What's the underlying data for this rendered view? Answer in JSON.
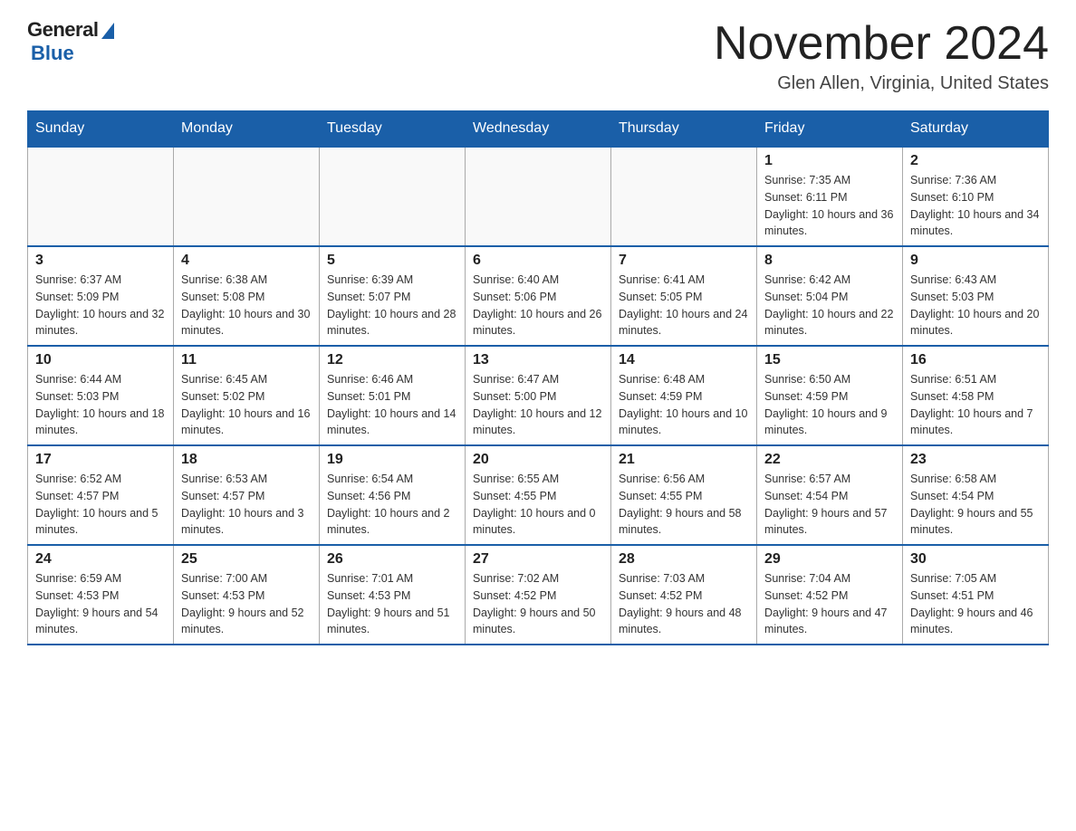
{
  "header": {
    "logo_general": "General",
    "logo_blue": "Blue",
    "month_title": "November 2024",
    "location": "Glen Allen, Virginia, United States"
  },
  "days_of_week": [
    "Sunday",
    "Monday",
    "Tuesday",
    "Wednesday",
    "Thursday",
    "Friday",
    "Saturday"
  ],
  "weeks": [
    [
      {
        "day": "",
        "info": ""
      },
      {
        "day": "",
        "info": ""
      },
      {
        "day": "",
        "info": ""
      },
      {
        "day": "",
        "info": ""
      },
      {
        "day": "",
        "info": ""
      },
      {
        "day": "1",
        "info": "Sunrise: 7:35 AM\nSunset: 6:11 PM\nDaylight: 10 hours and 36 minutes."
      },
      {
        "day": "2",
        "info": "Sunrise: 7:36 AM\nSunset: 6:10 PM\nDaylight: 10 hours and 34 minutes."
      }
    ],
    [
      {
        "day": "3",
        "info": "Sunrise: 6:37 AM\nSunset: 5:09 PM\nDaylight: 10 hours and 32 minutes."
      },
      {
        "day": "4",
        "info": "Sunrise: 6:38 AM\nSunset: 5:08 PM\nDaylight: 10 hours and 30 minutes."
      },
      {
        "day": "5",
        "info": "Sunrise: 6:39 AM\nSunset: 5:07 PM\nDaylight: 10 hours and 28 minutes."
      },
      {
        "day": "6",
        "info": "Sunrise: 6:40 AM\nSunset: 5:06 PM\nDaylight: 10 hours and 26 minutes."
      },
      {
        "day": "7",
        "info": "Sunrise: 6:41 AM\nSunset: 5:05 PM\nDaylight: 10 hours and 24 minutes."
      },
      {
        "day": "8",
        "info": "Sunrise: 6:42 AM\nSunset: 5:04 PM\nDaylight: 10 hours and 22 minutes."
      },
      {
        "day": "9",
        "info": "Sunrise: 6:43 AM\nSunset: 5:03 PM\nDaylight: 10 hours and 20 minutes."
      }
    ],
    [
      {
        "day": "10",
        "info": "Sunrise: 6:44 AM\nSunset: 5:03 PM\nDaylight: 10 hours and 18 minutes."
      },
      {
        "day": "11",
        "info": "Sunrise: 6:45 AM\nSunset: 5:02 PM\nDaylight: 10 hours and 16 minutes."
      },
      {
        "day": "12",
        "info": "Sunrise: 6:46 AM\nSunset: 5:01 PM\nDaylight: 10 hours and 14 minutes."
      },
      {
        "day": "13",
        "info": "Sunrise: 6:47 AM\nSunset: 5:00 PM\nDaylight: 10 hours and 12 minutes."
      },
      {
        "day": "14",
        "info": "Sunrise: 6:48 AM\nSunset: 4:59 PM\nDaylight: 10 hours and 10 minutes."
      },
      {
        "day": "15",
        "info": "Sunrise: 6:50 AM\nSunset: 4:59 PM\nDaylight: 10 hours and 9 minutes."
      },
      {
        "day": "16",
        "info": "Sunrise: 6:51 AM\nSunset: 4:58 PM\nDaylight: 10 hours and 7 minutes."
      }
    ],
    [
      {
        "day": "17",
        "info": "Sunrise: 6:52 AM\nSunset: 4:57 PM\nDaylight: 10 hours and 5 minutes."
      },
      {
        "day": "18",
        "info": "Sunrise: 6:53 AM\nSunset: 4:57 PM\nDaylight: 10 hours and 3 minutes."
      },
      {
        "day": "19",
        "info": "Sunrise: 6:54 AM\nSunset: 4:56 PM\nDaylight: 10 hours and 2 minutes."
      },
      {
        "day": "20",
        "info": "Sunrise: 6:55 AM\nSunset: 4:55 PM\nDaylight: 10 hours and 0 minutes."
      },
      {
        "day": "21",
        "info": "Sunrise: 6:56 AM\nSunset: 4:55 PM\nDaylight: 9 hours and 58 minutes."
      },
      {
        "day": "22",
        "info": "Sunrise: 6:57 AM\nSunset: 4:54 PM\nDaylight: 9 hours and 57 minutes."
      },
      {
        "day": "23",
        "info": "Sunrise: 6:58 AM\nSunset: 4:54 PM\nDaylight: 9 hours and 55 minutes."
      }
    ],
    [
      {
        "day": "24",
        "info": "Sunrise: 6:59 AM\nSunset: 4:53 PM\nDaylight: 9 hours and 54 minutes."
      },
      {
        "day": "25",
        "info": "Sunrise: 7:00 AM\nSunset: 4:53 PM\nDaylight: 9 hours and 52 minutes."
      },
      {
        "day": "26",
        "info": "Sunrise: 7:01 AM\nSunset: 4:53 PM\nDaylight: 9 hours and 51 minutes."
      },
      {
        "day": "27",
        "info": "Sunrise: 7:02 AM\nSunset: 4:52 PM\nDaylight: 9 hours and 50 minutes."
      },
      {
        "day": "28",
        "info": "Sunrise: 7:03 AM\nSunset: 4:52 PM\nDaylight: 9 hours and 48 minutes."
      },
      {
        "day": "29",
        "info": "Sunrise: 7:04 AM\nSunset: 4:52 PM\nDaylight: 9 hours and 47 minutes."
      },
      {
        "day": "30",
        "info": "Sunrise: 7:05 AM\nSunset: 4:51 PM\nDaylight: 9 hours and 46 minutes."
      }
    ]
  ]
}
